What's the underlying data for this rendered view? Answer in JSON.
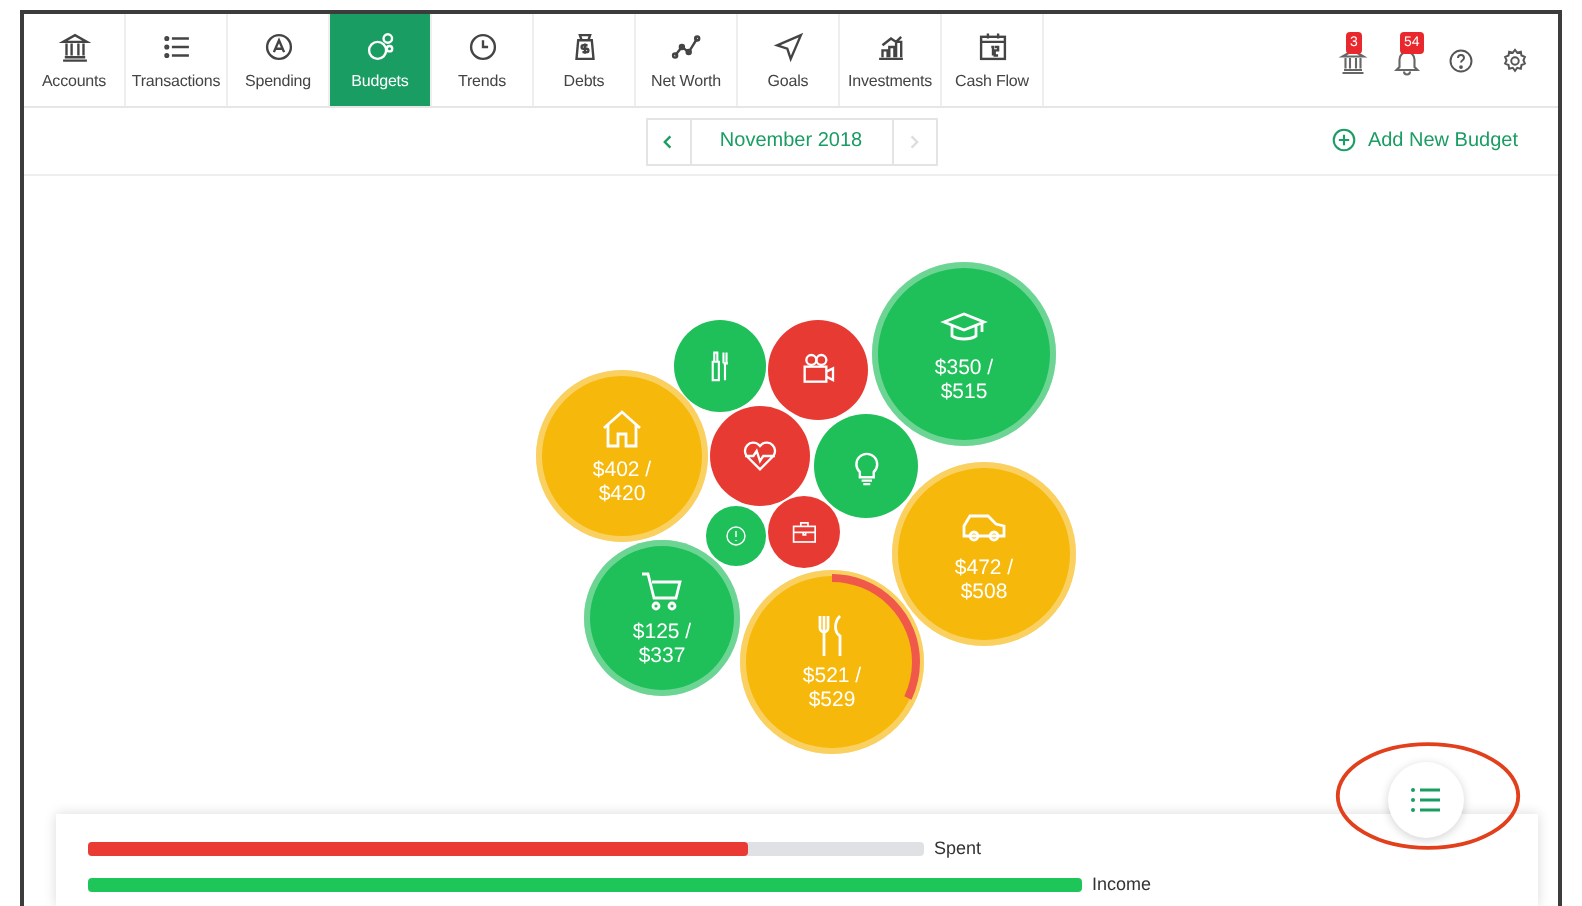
{
  "nav": {
    "tabs": [
      {
        "label": "Accounts",
        "selected": false
      },
      {
        "label": "Transactions",
        "selected": false
      },
      {
        "label": "Spending",
        "selected": false
      },
      {
        "label": "Budgets",
        "selected": true
      },
      {
        "label": "Trends",
        "selected": false
      },
      {
        "label": "Debts",
        "selected": false
      },
      {
        "label": "Net Worth",
        "selected": false
      },
      {
        "label": "Goals",
        "selected": false
      },
      {
        "label": "Investments",
        "selected": false
      },
      {
        "label": "Cash Flow",
        "selected": false
      }
    ],
    "alerts": [
      {
        "badge": "3"
      },
      {
        "badge": "54"
      }
    ]
  },
  "month_picker": {
    "month": "November 2018",
    "next_disabled": true
  },
  "add_budget": "Add New Budget",
  "bubbles": [
    {
      "color": "#1fbf5a",
      "ring": false
    },
    {
      "color": "#e63a33",
      "ring": false
    },
    {
      "color": "#1fbf5a",
      "ring": true,
      "amount": "$350 / $515"
    },
    {
      "color": "#f7b80c",
      "ring": true,
      "amount": "$402 / $420"
    },
    {
      "color": "#e63a33",
      "ring": false
    },
    {
      "color": "#1fbf5a",
      "ring": false
    },
    {
      "color": "#1fbf5a",
      "ring": false
    },
    {
      "color": "#e63a33",
      "ring": false
    },
    {
      "color": "#f7b80c",
      "ring": true,
      "amount": "$472 / $508"
    },
    {
      "color": "#1fbf5a",
      "ring": true,
      "amount": "$125 / $337"
    },
    {
      "color": "#f7b80c",
      "ring": true,
      "amount": "$521 / $529",
      "level": 0.32
    }
  ],
  "summary": [
    {
      "kind": "spent",
      "label": "Spent",
      "level": 0.79
    },
    {
      "kind": "income",
      "label": "Income"
    }
  ]
}
